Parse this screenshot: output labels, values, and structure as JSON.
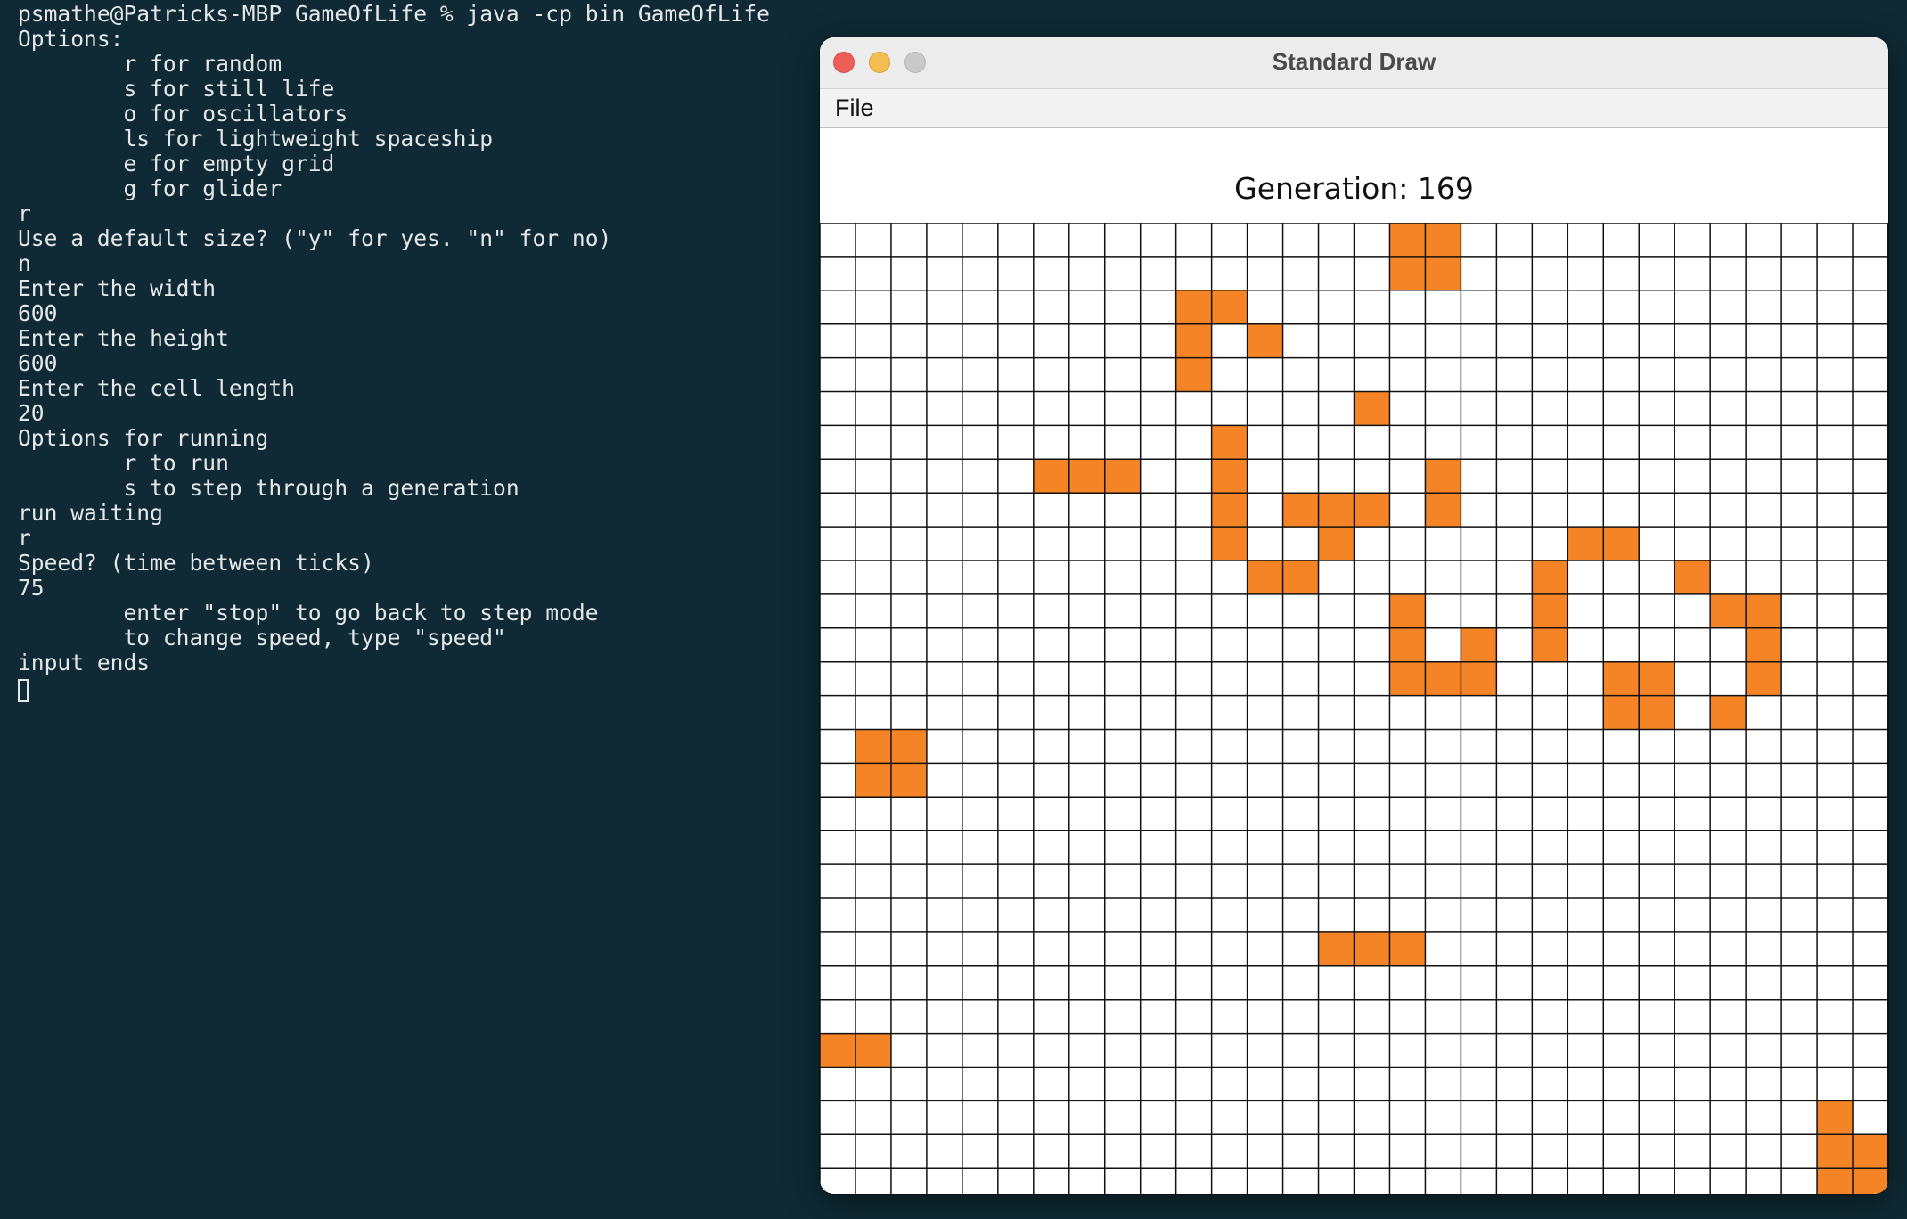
{
  "terminal": {
    "lines": [
      "psmathe@Patricks-MBP GameOfLife % java -cp bin GameOfLife",
      "Options:",
      "        r for random",
      "        s for still life",
      "        o for oscillators",
      "        ls for lightweight spaceship",
      "        e for empty grid",
      "        g for glider",
      "r",
      "Use a default size? (\"y\" for yes. \"n\" for no)",
      "n",
      "Enter the width",
      "600",
      "Enter the height",
      "600",
      "Enter the cell length",
      "20",
      "Options for running",
      "        r to run",
      "        s to step through a generation",
      "run waiting",
      "r",
      "Speed? (time between ticks)",
      "75",
      "        enter \"stop\" to go back to step mode",
      "        to change speed, type \"speed\"",
      "input ends"
    ]
  },
  "window": {
    "title": "Standard Draw",
    "menu": [
      "File"
    ],
    "generation_label": "Generation: 169"
  },
  "grid": {
    "columns": 30,
    "rows": 30,
    "cell_color": "#f58426",
    "line_color": "#111111",
    "live_cells": [
      [
        0,
        16
      ],
      [
        0,
        17
      ],
      [
        1,
        16
      ],
      [
        1,
        17
      ],
      [
        2,
        10
      ],
      [
        2,
        11
      ],
      [
        3,
        10
      ],
      [
        3,
        12
      ],
      [
        4,
        10
      ],
      [
        5,
        15
      ],
      [
        6,
        11
      ],
      [
        7,
        6
      ],
      [
        7,
        7
      ],
      [
        7,
        8
      ],
      [
        7,
        11
      ],
      [
        7,
        17
      ],
      [
        8,
        11
      ],
      [
        8,
        13
      ],
      [
        8,
        14
      ],
      [
        8,
        15
      ],
      [
        8,
        17
      ],
      [
        9,
        11
      ],
      [
        9,
        14
      ],
      [
        9,
        21
      ],
      [
        9,
        22
      ],
      [
        10,
        12
      ],
      [
        10,
        13
      ],
      [
        10,
        20
      ],
      [
        10,
        24
      ],
      [
        11,
        16
      ],
      [
        11,
        20
      ],
      [
        11,
        25
      ],
      [
        11,
        26
      ],
      [
        12,
        16
      ],
      [
        12,
        18
      ],
      [
        12,
        20
      ],
      [
        12,
        26
      ],
      [
        13,
        16
      ],
      [
        13,
        17
      ],
      [
        13,
        18
      ],
      [
        13,
        22
      ],
      [
        13,
        23
      ],
      [
        13,
        26
      ],
      [
        14,
        22
      ],
      [
        14,
        23
      ],
      [
        14,
        25
      ],
      [
        15,
        1
      ],
      [
        15,
        2
      ],
      [
        16,
        1
      ],
      [
        16,
        2
      ],
      [
        21,
        14
      ],
      [
        21,
        15
      ],
      [
        21,
        16
      ],
      [
        24,
        0
      ],
      [
        24,
        1
      ],
      [
        26,
        28
      ],
      [
        27,
        28
      ],
      [
        27,
        29
      ],
      [
        28,
        28
      ],
      [
        28,
        29
      ]
    ]
  }
}
